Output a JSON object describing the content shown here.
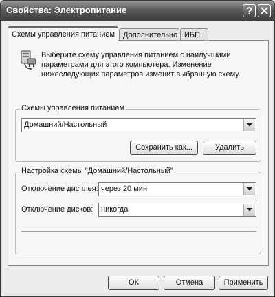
{
  "window": {
    "title": "Свойства: Электропитание"
  },
  "titlebar": {
    "help_icon": "question-mark",
    "close_icon": "x"
  },
  "tabs": [
    {
      "label": "Схемы управления питанием",
      "active": true
    },
    {
      "label": "Дополнительно",
      "active": false
    },
    {
      "label": "ИБП",
      "active": false
    }
  ],
  "schemes_tab": {
    "description": "Выберите схему управления питанием с наилучшими параметрами для этого компьютера. Изменение нижеследующих параметров изменит выбранную схему.",
    "power_icon": "power-plug-computer",
    "schemes_group_label": "Схемы управления питанием",
    "selected_scheme": "Домашний/Настольный",
    "save_as_label": "Сохранить как...",
    "delete_label": "Удалить",
    "settings_group_label": "Настройка схемы \"Домашний/Настольный\"",
    "display_off_label": "Отключение дисплея:",
    "display_off_value": "через 20 мин",
    "disks_off_label": "Отключение дисков:",
    "disks_off_value": "никогда"
  },
  "footer": {
    "ok_label": "ОК",
    "cancel_label": "Отмена",
    "apply_label": "Применить"
  },
  "colors": {
    "titlebar": "#5a5a5a",
    "panel": "#f6f6f6",
    "dialog": "#ececec"
  }
}
